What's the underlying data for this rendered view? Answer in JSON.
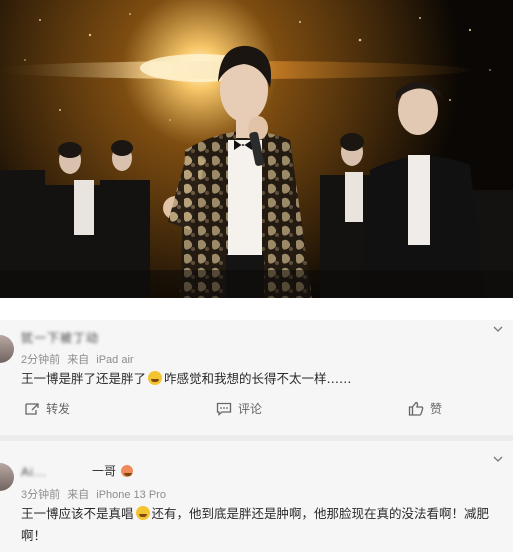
{
  "comments": [
    {
      "username": "犹一下被丁动",
      "time": "2分钟前",
      "source_prefix": "来自",
      "device": "iPad air",
      "text_part1": "王一博是胖了还是胖了",
      "emoji": "grinning-sweat-emoji",
      "text_part2": "咋感觉和我想的长得不太一样……"
    },
    {
      "username": "Ai...",
      "username_suffix": "一哥",
      "time": "3分钟前",
      "source_prefix": "来自",
      "device": "iPhone 13 Pro",
      "text_part1": "王一博应该不是真唱",
      "emoji": "grinning-sweat-emoji",
      "text_part2": "还有，他到底是胖还是肿啊，他那脸现在真的没法看啊！减肥啊！"
    }
  ],
  "actions": {
    "repost": "转发",
    "comment": "评论",
    "like": "赞"
  },
  "colors": {
    "card_background": "#f6f6f6",
    "meta_gray": "#8d8d8d",
    "stage_gold": "#e8b04a"
  }
}
